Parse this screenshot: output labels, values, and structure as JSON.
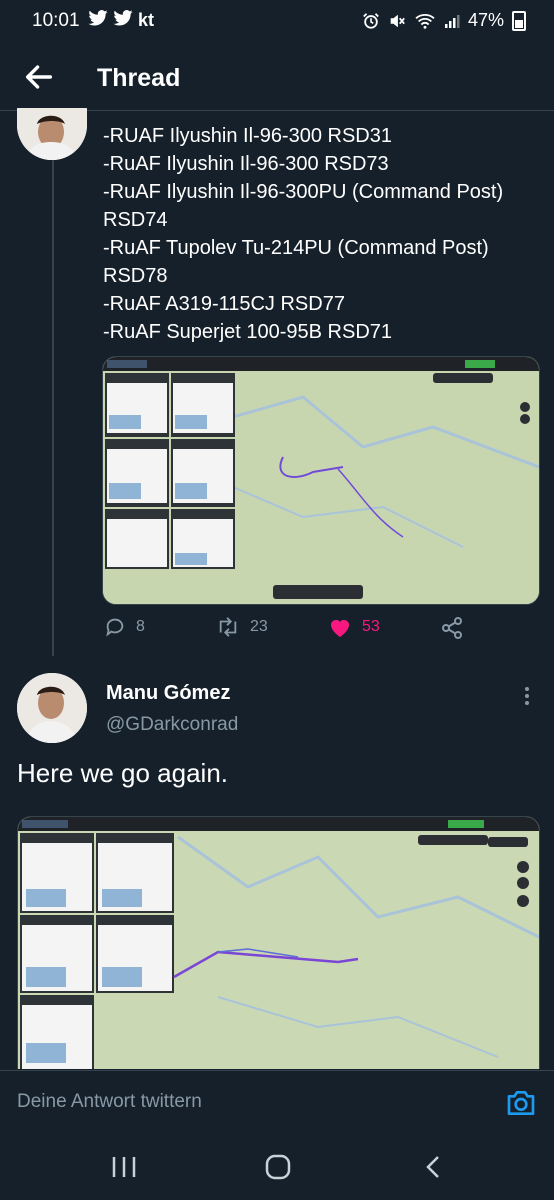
{
  "status_bar": {
    "time": "10:01",
    "left_icons": [
      "twitter-icon",
      "twitter-icon",
      "kt"
    ],
    "battery": "47%"
  },
  "header": {
    "title": "Thread"
  },
  "tweet1": {
    "lines": [
      "-RUAF Ilyushin Il-96-300 RSD31",
      "-RuAF Ilyushin Il-96-300 RSD73",
      "-RuAF Ilyushin Il-96-300PU (Command Post)",
      "RSD74",
      "-RuAF Tupolev Tu-214PU (Command Post)",
      "RSD78",
      "-RuAF A319-115CJ RSD77",
      "-RuAF Superjet 100-95B RSD71"
    ],
    "replies": "8",
    "retweets": "23",
    "likes": "53"
  },
  "tweet2": {
    "author": "Manu Gómez",
    "handle": "@GDarkconrad",
    "text": "Here we go again."
  },
  "reply": {
    "placeholder": "Deine Antwort twittern"
  },
  "colors": {
    "background": "#15202b",
    "muted": "#8899a6",
    "like": "#f91880",
    "link": "#1d9bf0"
  }
}
